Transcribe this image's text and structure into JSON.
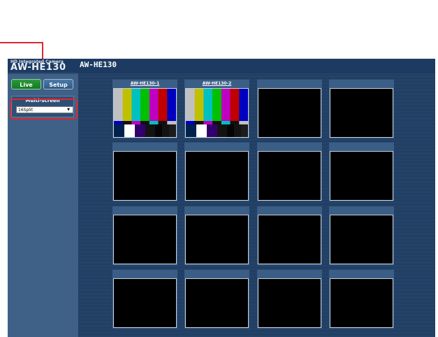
{
  "header": {
    "brand_small": "HD Integrated Camera",
    "brand_large": "AW-HE130",
    "title": "AW-HE130"
  },
  "sidebar": {
    "tabs": [
      {
        "label": "Live",
        "active": true
      },
      {
        "label": "Setup",
        "active": false
      }
    ],
    "multiscreen": {
      "label": "Multi-screen",
      "selected": "16Split"
    }
  },
  "grid": {
    "cells": [
      {
        "label": "AW-HE130-1",
        "has_video": true
      },
      {
        "label": "AW-HE130-2",
        "has_video": true
      },
      {
        "label": "",
        "has_video": false
      },
      {
        "label": "",
        "has_video": false
      },
      {
        "label": "",
        "has_video": false
      },
      {
        "label": "",
        "has_video": false
      },
      {
        "label": "",
        "has_video": false
      },
      {
        "label": "",
        "has_video": false
      },
      {
        "label": "",
        "has_video": false
      },
      {
        "label": "",
        "has_video": false
      },
      {
        "label": "",
        "has_video": false
      },
      {
        "label": "",
        "has_video": false
      },
      {
        "label": "",
        "has_video": false
      },
      {
        "label": "",
        "has_video": false
      },
      {
        "label": "",
        "has_video": false
      },
      {
        "label": "",
        "has_video": false
      }
    ]
  },
  "colors": {
    "annotation": "#e0262e",
    "live_tab": "#1f8a2f",
    "header": "#1d3b62"
  }
}
